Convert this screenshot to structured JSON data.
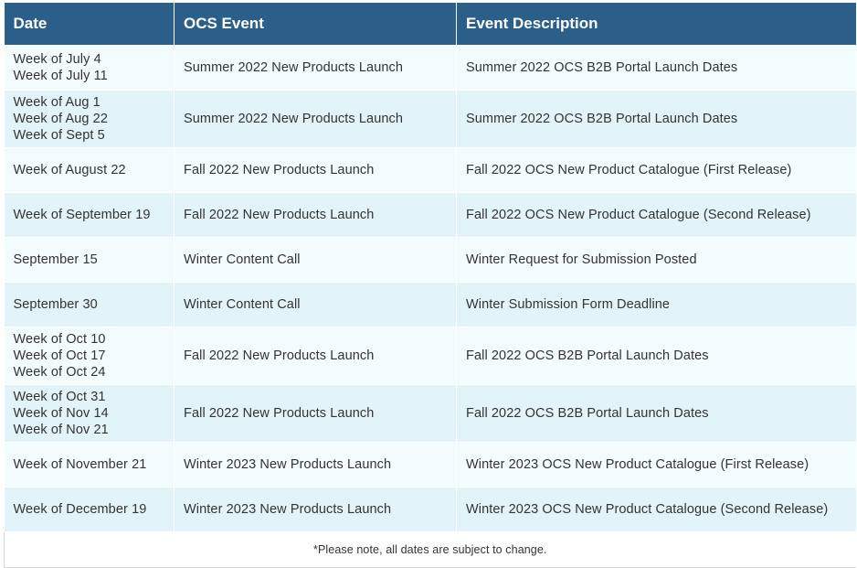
{
  "headers": [
    "Date",
    "OCS Event",
    "Event Description"
  ],
  "rows": [
    {
      "date": "Week of July 4\nWeek  of July 11",
      "event": "Summer 2022 New Products Launch",
      "description": "Summer 2022 OCS B2B Portal Launch Dates"
    },
    {
      "date": "Week of Aug 1\nWeek of Aug 22\nWeek of Sept 5",
      "event": "Summer 2022 New Products Launch",
      "description": "Summer 2022 OCS B2B Portal Launch Dates"
    },
    {
      "date": "Week of August 22",
      "event": "Fall 2022 New Products Launch",
      "description": "Fall 2022 OCS New Product Catalogue (First Release)"
    },
    {
      "date": "Week of September 19",
      "event": "Fall 2022 New Products Launch",
      "description": "Fall 2022 OCS New Product Catalogue (Second Release)"
    },
    {
      "date": "September 15",
      "event": "Winter Content Call",
      "description": "Winter Request for Submission Posted"
    },
    {
      "date": "September 30",
      "event": "Winter Content Call",
      "description": "Winter Submission Form Deadline"
    },
    {
      "date": "Week of Oct 10\nWeek of Oct 17\nWeek of Oct 24",
      "event": "Fall 2022 New Products Launch",
      "description": "Fall 2022 OCS B2B Portal Launch Dates"
    },
    {
      "date": "Week of Oct 31\nWeek of Nov 14\nWeek of Nov 21",
      "event": "Fall 2022 New Products Launch",
      "description": "Fall 2022 OCS B2B Portal Launch Dates"
    },
    {
      "date": "Week of November 21",
      "event": "Winter 2023 New Products Launch",
      "description": "Winter 2023 OCS New Product Catalogue (First Release)"
    },
    {
      "date": "Week of December 19",
      "event": "Winter 2023 New Products Launch",
      "description": "Winter 2023 OCS New Product Catalogue (Second Release)"
    }
  ],
  "note": "*Please note, all dates are subject to change.",
  "colors": {
    "header_bg": "#2b5f8a",
    "row_odd": "#f3fcfd",
    "row_even": "#e3f3fa"
  }
}
